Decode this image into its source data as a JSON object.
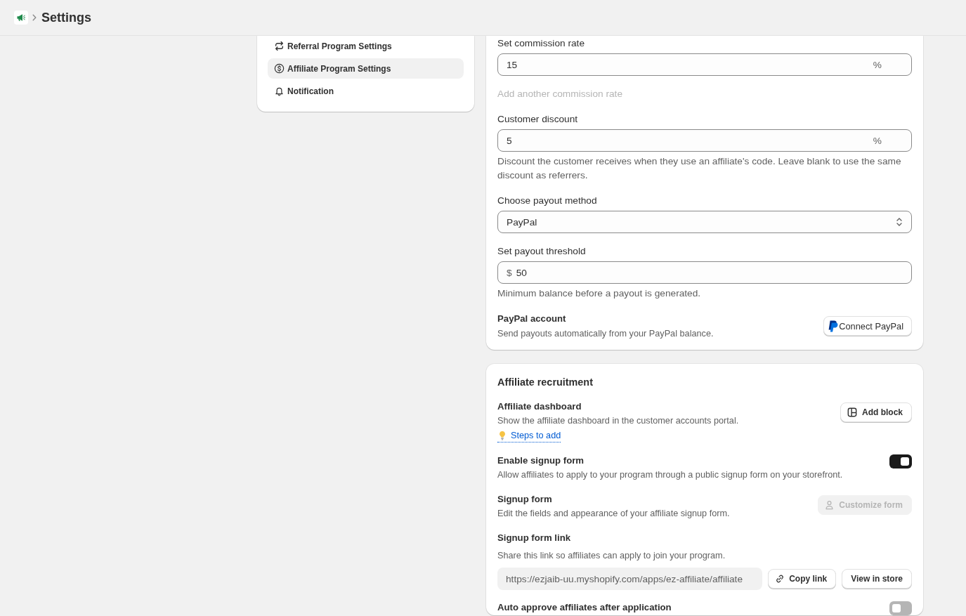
{
  "header": {
    "title": "Settings"
  },
  "nav": {
    "items": [
      {
        "label": "Referral Program Settings",
        "selected": false
      },
      {
        "label": "Affiliate Program Settings",
        "selected": true
      },
      {
        "label": "Notification",
        "selected": false
      }
    ]
  },
  "payout_settings": {
    "commission_rate": {
      "label": "Set commission rate",
      "value": "15",
      "suffix": "%"
    },
    "add_commission_rate": {
      "label": "Add another commission rate",
      "disabled": true
    },
    "customer_discount": {
      "label": "Customer discount",
      "value": "5",
      "suffix": "%",
      "help": "Discount the customer receives when they use an affiliate's code. Leave blank to use the same discount as referrers."
    },
    "payout_method": {
      "label": "Choose payout method",
      "value": "PayPal"
    },
    "payout_threshold": {
      "label": "Set payout threshold",
      "prefix": "$",
      "value": "50",
      "help": "Minimum balance before a payout is generated."
    },
    "paypal_account": {
      "title": "PayPal account",
      "description": "Send payouts automatically from your PayPal balance.",
      "button": "Connect PayPal"
    }
  },
  "recruitment": {
    "title": "Affiliate recruitment",
    "sections": [
      {
        "kind": "action",
        "title": "Affiliate dashboard",
        "description": "Show the affiliate dashboard in the customer accounts portal.",
        "button": {
          "label": "Add block",
          "disabled": false
        },
        "tip": "Steps to add"
      },
      {
        "kind": "toggle",
        "title": "Enable signup form",
        "description": "Allow affiliates to apply to your program through a public signup form on your storefront.",
        "on": true
      },
      {
        "kind": "action",
        "title": "Signup form",
        "description": "Edit the fields and appearance of your affiliate signup form.",
        "button": {
          "label": "Customize form",
          "disabled": true
        }
      },
      {
        "kind": "share",
        "title": "Signup form link",
        "description": "Share this link so affiliates can apply to join your program.",
        "url": "https://ezjaib-uu.myshopify.com/apps/ez-affiliate/affiliate",
        "buttons": [
          "Copy link",
          "View in store"
        ]
      },
      {
        "kind": "toggle",
        "title": "Auto approve affiliates after application",
        "on": false
      }
    ]
  }
}
